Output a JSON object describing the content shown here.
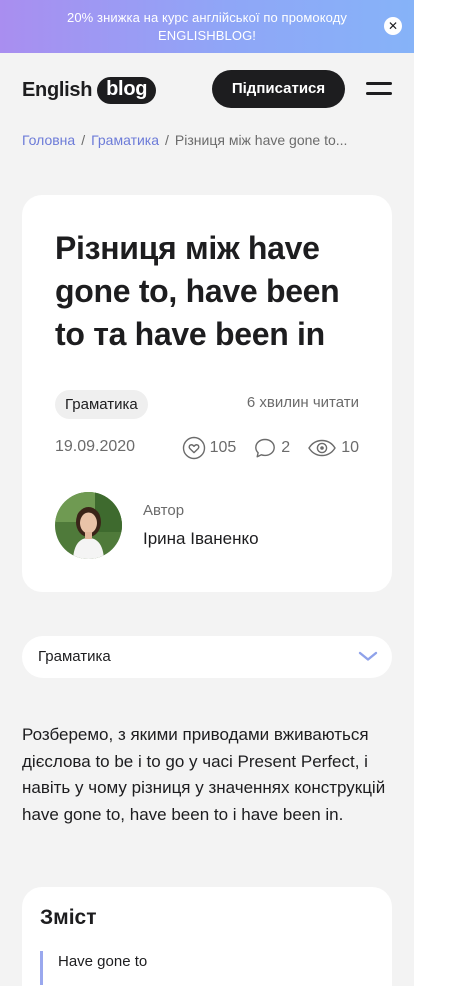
{
  "promo": {
    "text": "20% знижка на курс англійської по промокоду ENGLISHBLOG!",
    "close_icon": "close-icon"
  },
  "header": {
    "logo_word": "English",
    "logo_badge": "blog",
    "subscribe_label": "Підписатися",
    "menu_icon": "menu-icon"
  },
  "breadcrumb": {
    "items": [
      "Головна",
      "Граматика",
      "Різниця між have gone to..."
    ],
    "separator": "/"
  },
  "article": {
    "title": "Різниця між have gone to, have been to та have been in",
    "category": "Граматика",
    "read_time": "6 хвилин читати",
    "date": "19.09.2020",
    "likes": "105",
    "comments": "2",
    "views": "10",
    "author_label": "Автор",
    "author_name": "Ірина Іваненко"
  },
  "category_select": {
    "value": "Граматика",
    "icon": "chevron-down-icon"
  },
  "intro": "Розберемо, з якими приводами вживаються дієслова to be і to go у часі Present Perfect, і навіть у чому різниця у значеннях конструкцій have gone to, have been to і have been in.",
  "toc": {
    "title": "Зміст",
    "items": [
      "Have gone to"
    ]
  },
  "colors": {
    "accent": "#6c7bd8",
    "dark": "#1d1d1f",
    "background": "#f3f3f3",
    "promo_gradient_start": "#a98ef0",
    "promo_gradient_end": "#86b3f8"
  }
}
